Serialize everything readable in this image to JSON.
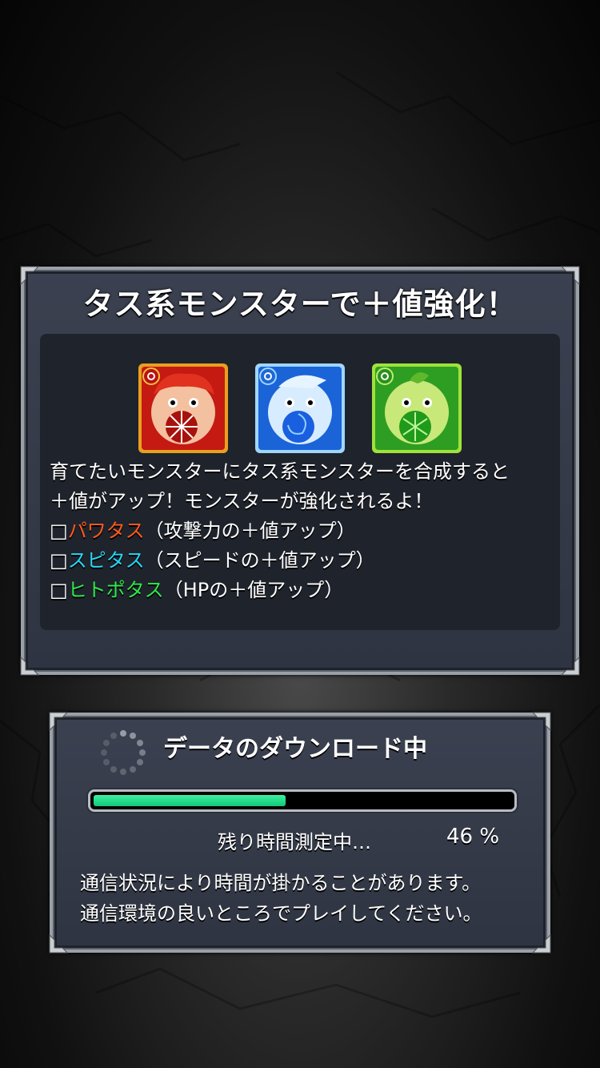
{
  "info_panel": {
    "title": "タス系モンスターで＋値強化！",
    "monsters": [
      {
        "icon": "red-tasu-monster-icon",
        "color": "#d8261a"
      },
      {
        "icon": "blue-tasu-monster-icon",
        "color": "#1f6fe6"
      },
      {
        "icon": "green-tasu-monster-icon",
        "color": "#3dbb2b"
      }
    ],
    "description_line1": "育てたいモンスターにタス系モンスターを合成すると",
    "description_line2": "＋値がアップ！モンスターが強化されるよ！",
    "items": [
      {
        "box": "□",
        "name": "パワタス",
        "detail": "（攻撃力の＋値アップ）",
        "color": "#ff5a1e"
      },
      {
        "box": "□",
        "name": "スピタス",
        "detail": "（スピードの＋値アップ）",
        "color": "#27d6f5"
      },
      {
        "box": "□",
        "name": "ヒトポタス",
        "detail": "（HPの＋値アップ）",
        "color": "#2ee84a"
      }
    ]
  },
  "download_panel": {
    "title": "データのダウンロード中",
    "spinner_icon": "loading-spinner-icon",
    "progress_percent": 46,
    "eta_text": "残り時間測定中…",
    "percent_text": "46 %",
    "note_line1": "通信状況により時間が掛かることがあります。",
    "note_line2": "通信環境の良いところでプレイしてください。",
    "progress_color": "#21d685"
  }
}
